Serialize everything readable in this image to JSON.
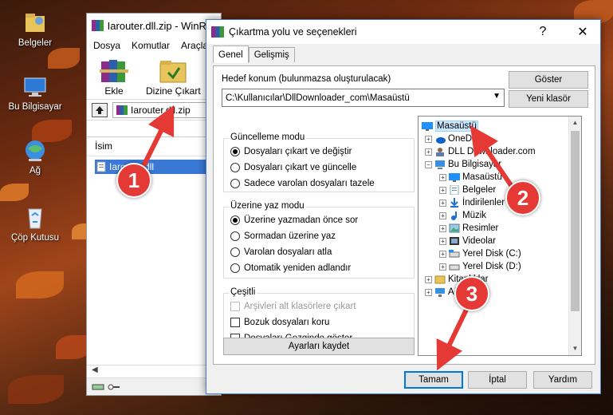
{
  "desktop": {
    "icons": [
      {
        "label": "Belgeler",
        "icon": "documents-folder-icon"
      },
      {
        "label": "Bu Bilgisayar",
        "icon": "computer-icon"
      },
      {
        "label": "Ağ",
        "icon": "network-icon"
      },
      {
        "label": "Çöp Kutusu",
        "icon": "recycle-bin-icon"
      }
    ]
  },
  "winrar": {
    "title": "Iarouter.dll.zip - WinRAR",
    "menu": [
      "Dosya",
      "Komutlar",
      "Araçlar"
    ],
    "toolbar": {
      "add": "Ekle",
      "extract": "Dizine Çıkart"
    },
    "address": "Iarouter.dll.zip",
    "column_name": "İsim",
    "file": "Iarouter.dll"
  },
  "dialog": {
    "title": "Çıkartma yolu ve seçenekleri",
    "help_glyph": "?",
    "close_glyph": "✕",
    "tabs": [
      "Genel",
      "Gelişmiş"
    ],
    "dest_label": "Hedef konum (bulunmazsa oluşturulacak)",
    "dest_value": "C:\\Kullanıcılar\\DllDownloader_com\\Masaüstü",
    "show_button": "Göster",
    "new_folder_button": "Yeni klasör",
    "update_mode": {
      "title": "Güncelleme modu",
      "options": [
        "Dosyaları çıkart ve değiştir",
        "Dosyaları çıkart ve güncelle",
        "Sadece varolan dosyaları tazele"
      ],
      "selected": 0
    },
    "overwrite_mode": {
      "title": "Üzerine yaz modu",
      "options": [
        "Üzerine yazmadan önce sor",
        "Sormadan üzerine yaz",
        "Varolan dosyaları atla",
        "Otomatik yeniden adlandır"
      ],
      "selected": 0
    },
    "misc": {
      "title": "Çeşitli",
      "options": [
        "Arşivleri alt klasörlere çıkart",
        "Bozuk dosyaları koru",
        "Dosyaları Gezginde göster"
      ]
    },
    "save_settings": "Ayarları kaydet",
    "tree": [
      {
        "label": "Masaüstü",
        "icon": "desktop-icon",
        "selected": true
      },
      {
        "label": "OneDrive",
        "icon": "onedrive-icon"
      },
      {
        "label": "DLL Downloader.com",
        "icon": "user-folder-icon"
      },
      {
        "label": "Bu Bilgisayar",
        "icon": "computer-icon"
      },
      {
        "label": "Masaüstü",
        "icon": "desktop-icon"
      },
      {
        "label": "Belgeler",
        "icon": "documents-icon"
      },
      {
        "label": "İndirilenler",
        "icon": "downloads-icon"
      },
      {
        "label": "Müzik",
        "icon": "music-icon"
      },
      {
        "label": "Resimler",
        "icon": "pictures-icon"
      },
      {
        "label": "Videolar",
        "icon": "videos-icon"
      },
      {
        "label": "Yerel Disk (C:)",
        "icon": "drive-icon"
      },
      {
        "label": "Yerel Disk (D:)",
        "icon": "drive-icon"
      },
      {
        "label": "Kitaplıklar",
        "icon": "libraries-icon"
      },
      {
        "label": "Ağ",
        "icon": "network-icon"
      }
    ],
    "ok": "Tamam",
    "cancel": "İptal",
    "help": "Yardım"
  },
  "annotations": [
    "1",
    "2",
    "3"
  ],
  "colors": {
    "annotation": "#e53935",
    "selection": "#cce8ff",
    "accent": "#0078d7"
  }
}
